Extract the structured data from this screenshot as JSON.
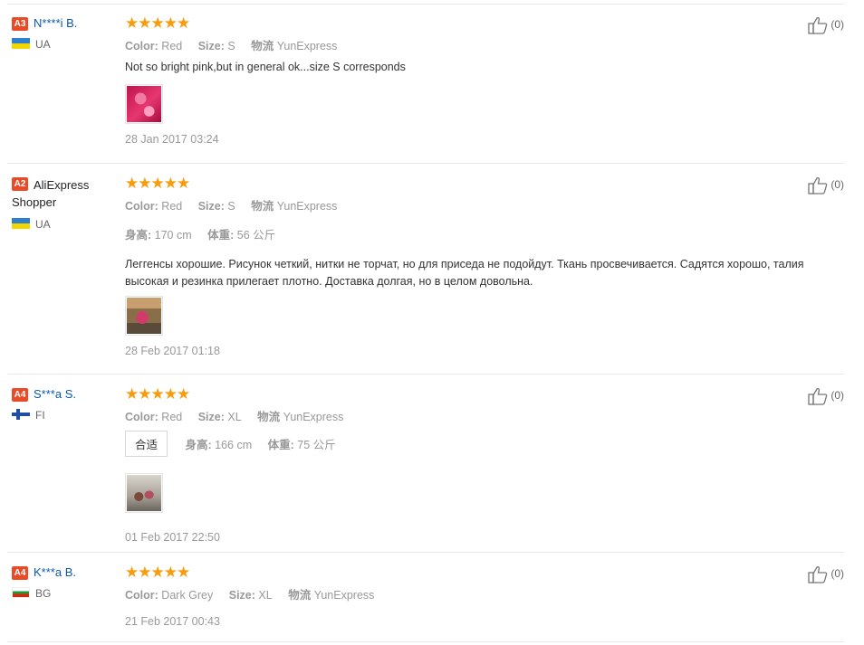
{
  "reviews": [
    {
      "level": "A3",
      "user": "N****i B.",
      "country": "UA",
      "stars": "★★★★★",
      "attrs": [
        {
          "label": "Color:",
          "value": "Red"
        },
        {
          "label": "Size:",
          "value": "S"
        },
        {
          "label": "物流",
          "value": "YunExpress"
        }
      ],
      "text": "Not so bright pink,but in general ok...size S corresponds",
      "date": "28 Jan 2017 03:24",
      "helpful": "(0)"
    },
    {
      "level": "A2",
      "user": "AliExpress Shopper",
      "country": "UA",
      "stars": "★★★★★",
      "attrs": [
        {
          "label": "Color:",
          "value": "Red"
        },
        {
          "label": "Size:",
          "value": "S"
        },
        {
          "label": "物流",
          "value": "YunExpress"
        }
      ],
      "body": [
        {
          "label": "身高:",
          "value": "170 cm"
        },
        {
          "label": "体重:",
          "value": "56 公斤"
        }
      ],
      "text": "Леггенсы хорошие. Рисунок четкий, нитки не торчат, но для приседа не подойдут. Ткань просвечивается. Садятся хорошо, талия высокая и резинка прилегает плотно. Доставка долгая, но в целом довольна.",
      "date": "28 Feb 2017 01:18",
      "helpful": "(0)"
    },
    {
      "level": "A4",
      "user": "S***a S.",
      "country": "FI",
      "stars": "★★★★★",
      "attrs": [
        {
          "label": "Color:",
          "value": "Red"
        },
        {
          "label": "Size:",
          "value": "XL"
        },
        {
          "label": "物流",
          "value": "YunExpress"
        }
      ],
      "fit_tag": "合适",
      "body": [
        {
          "label": "身高:",
          "value": "166 cm"
        },
        {
          "label": "体重:",
          "value": "75 公斤"
        }
      ],
      "date": "01 Feb 2017 22:50",
      "helpful": "(0)"
    },
    {
      "level": "A4",
      "user": "K***a B.",
      "country": "BG",
      "stars": "★★★★★",
      "attrs": [
        {
          "label": "Color:",
          "value": "Dark Grey"
        },
        {
          "label": "Size:",
          "value": "XL"
        },
        {
          "label": "物流",
          "value": "YunExpress"
        }
      ],
      "date": "21 Feb 2017 00:43",
      "helpful": "(0)"
    }
  ],
  "colors": {
    "level_badge": "#e84b25",
    "star": "#f89b0c",
    "username": "#0b5aa6"
  },
  "icons": {
    "like": "thumbs-up-icon",
    "rating": "star-icon"
  }
}
